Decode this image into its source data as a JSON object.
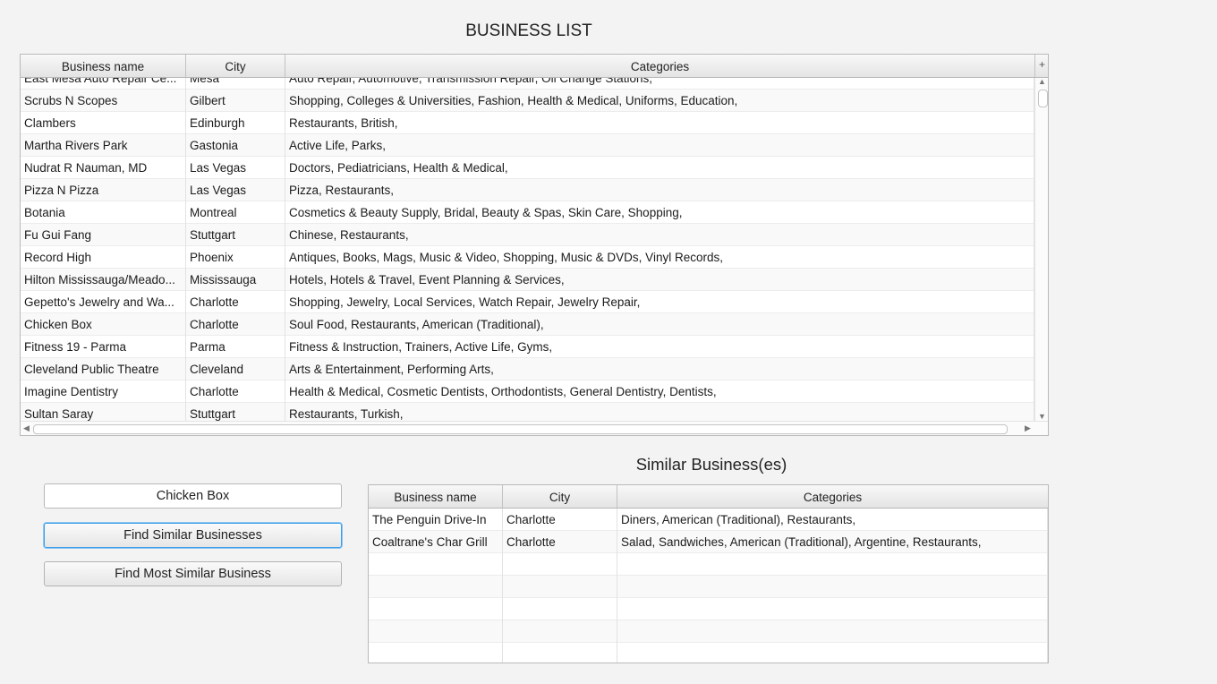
{
  "main_title": "BUSINESS LIST",
  "business_table": {
    "columns": [
      "Business name",
      "City",
      "Categories"
    ],
    "corner_icon": "+",
    "rows": [
      [
        "East Mesa Auto Repair Ce...",
        "Mesa",
        "Auto Repair, Automotive, Transmission Repair, Oil Change Stations,"
      ],
      [
        "Scrubs N Scopes",
        "Gilbert",
        "Shopping, Colleges & Universities, Fashion, Health & Medical, Uniforms, Education,"
      ],
      [
        "Clambers",
        "Edinburgh",
        "Restaurants, British,"
      ],
      [
        "Martha Rivers Park",
        "Gastonia",
        "Active Life, Parks,"
      ],
      [
        "Nudrat R Nauman, MD",
        "Las Vegas",
        "Doctors, Pediatricians, Health & Medical,"
      ],
      [
        "Pizza N Pizza",
        "Las Vegas",
        "Pizza, Restaurants,"
      ],
      [
        "Botania",
        "Montreal",
        "Cosmetics & Beauty Supply, Bridal, Beauty & Spas, Skin Care, Shopping,"
      ],
      [
        "Fu Gui Fang",
        "Stuttgart",
        "Chinese, Restaurants,"
      ],
      [
        "Record High",
        "Phoenix",
        "Antiques, Books, Mags, Music & Video, Shopping, Music & DVDs, Vinyl Records,"
      ],
      [
        "Hilton Mississauga/Meado...",
        "Mississauga",
        "Hotels, Hotels & Travel, Event Planning & Services,"
      ],
      [
        "Gepetto's Jewelry and Wa...",
        "Charlotte",
        "Shopping, Jewelry, Local Services, Watch Repair, Jewelry Repair,"
      ],
      [
        "Chicken Box",
        "Charlotte",
        "Soul Food, Restaurants, American (Traditional),"
      ],
      [
        "Fitness 19 - Parma",
        "Parma",
        "Fitness & Instruction, Trainers, Active Life, Gyms,"
      ],
      [
        "Cleveland Public Theatre",
        "Cleveland",
        "Arts & Entertainment, Performing Arts,"
      ],
      [
        "Imagine Dentistry",
        "Charlotte",
        "Health & Medical, Cosmetic Dentists, Orthodontists, General Dentistry, Dentists,"
      ],
      [
        "Sultan Saray",
        "Stuttgart",
        "Restaurants, Turkish,"
      ]
    ]
  },
  "business_input": {
    "value": "Chicken Box"
  },
  "buttons": {
    "find_similar": "Find Similar Businesses",
    "find_most_similar": "Find Most Similar Business"
  },
  "similar_title": "Similar Business(es)",
  "similar_table": {
    "columns": [
      "Business name",
      "City",
      "Categories"
    ],
    "rows": [
      [
        "The Penguin Drive-In",
        "Charlotte",
        "Diners, American (Traditional), Restaurants,"
      ],
      [
        "Coaltrane's Char Grill",
        "Charlotte",
        "Salad, Sandwiches, American (Traditional), Argentine, Restaurants,"
      ]
    ],
    "empty_rows": 5
  }
}
